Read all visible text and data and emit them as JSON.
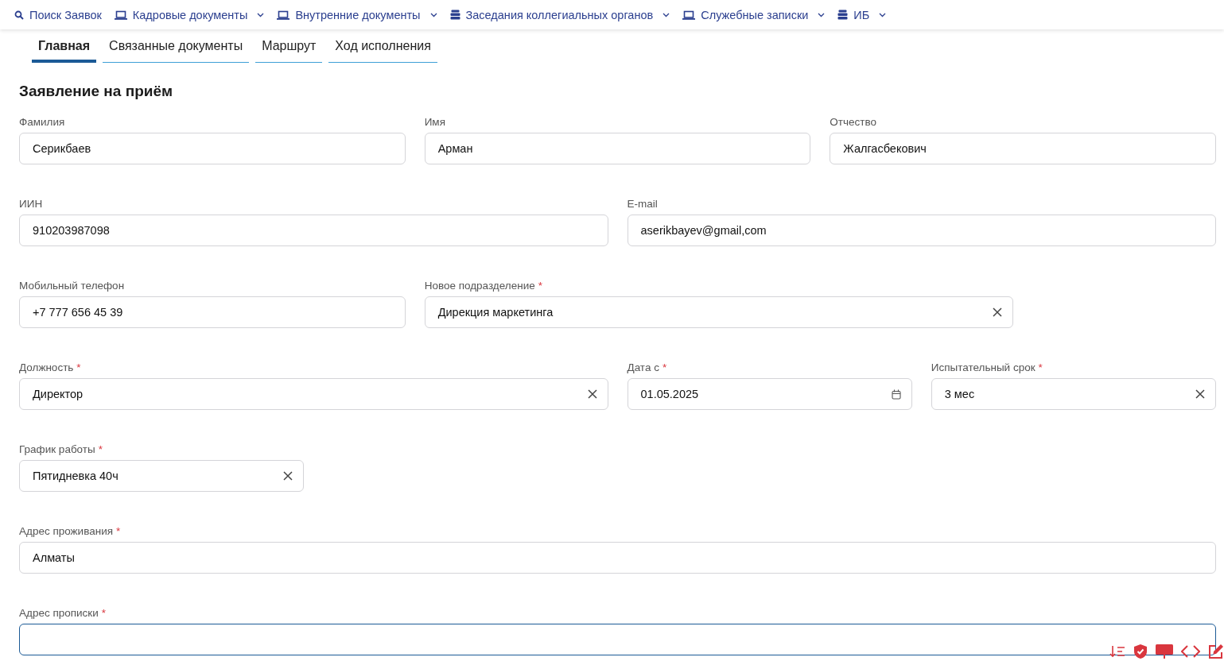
{
  "nav": [
    {
      "label": "Поиск Заявок",
      "dropdown": false
    },
    {
      "label": "Кадровые документы",
      "dropdown": true
    },
    {
      "label": "Внутренние документы",
      "dropdown": true
    },
    {
      "label": "Заседания коллегиальных органов",
      "dropdown": true
    },
    {
      "label": "Служебные записки",
      "dropdown": true
    },
    {
      "label": "ИБ",
      "dropdown": true
    }
  ],
  "tabs": [
    {
      "label": "Главная",
      "selected": true
    },
    {
      "label": "Связанные документы",
      "selected": false
    },
    {
      "label": "Маршрут",
      "selected": false
    },
    {
      "label": "Ход исполнения",
      "selected": false
    }
  ],
  "form": {
    "title": "Заявление на приём",
    "rows": [
      [
        {
          "label": "Фамилия",
          "kind": "text",
          "value": "Серикбаев",
          "focused": false
        },
        {
          "label": "Имя",
          "kind": "text",
          "value": "Арман",
          "focused": false
        },
        {
          "label": "Отчество",
          "kind": "text",
          "value": "Жалгасбекович",
          "focused": false
        }
      ],
      [
        {
          "label": "ИИН",
          "kind": "text",
          "value": "910203987098",
          "focused": false
        },
        {
          "label": "E-mail",
          "kind": "text",
          "value": "aserikbayev@gmail,com",
          "focused": false
        }
      ],
      [
        {
          "label": "Мобильный телефон",
          "kind": "text",
          "value": "+7 777 656 45 39",
          "focused": false
        },
        {
          "label": "Новое подразделение",
          "required_mark": "*",
          "kind": "select",
          "value": "Дирекция маркетинга",
          "focused": false
        }
      ],
      [
        {
          "label": "Должность",
          "required_mark": "*",
          "kind": "select",
          "value": "Директор",
          "focused": false
        },
        {
          "label": "Дата с",
          "required_mark": "*",
          "kind": "date",
          "value": "01.05.2025",
          "focused": false
        },
        {
          "label": "Испытательный срок",
          "required_mark": "*",
          "kind": "select",
          "value": "3 мес",
          "focused": false
        }
      ],
      [
        {
          "label": "График работы",
          "required_mark": "*",
          "kind": "select",
          "value": "Пятидневка 40ч",
          "focused": false
        }
      ],
      [
        {
          "label": "Адрес проживания",
          "required_mark": "*",
          "kind": "text",
          "value": "Алматы",
          "focused": false
        }
      ],
      [
        {
          "label": "Адрес прописки",
          "required_mark": "*",
          "kind": "text",
          "focused": true
        }
      ]
    ]
  }
}
